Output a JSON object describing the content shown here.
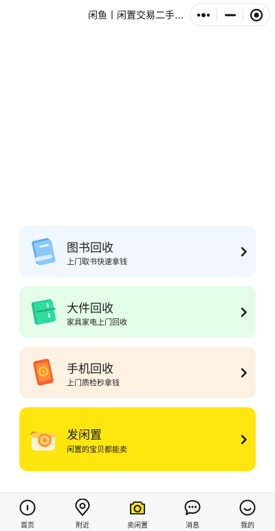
{
  "header": {
    "title": "闲鱼丨闲置交易二手...",
    "capsule": [
      "more-icon",
      "minimize-icon",
      "close-target-icon"
    ]
  },
  "cards": [
    {
      "title": "图书回收",
      "subtitle": "上门取书快速拿钱",
      "background": "#f1f7fe",
      "icon": "book-icon"
    },
    {
      "title": "大件回收",
      "subtitle": "家具家电上门回收",
      "background": "#e4fde8",
      "icon": "fridge-icon"
    },
    {
      "title": "手机回收",
      "subtitle": "上门质检秒拿钱",
      "background": "#fdf2e2",
      "icon": "phone-icon"
    },
    {
      "title": "发闲置",
      "subtitle": "闲置的宝贝都能卖",
      "background": "#ffe60f",
      "icon": "camera-icon"
    }
  ],
  "tabbar": {
    "items": [
      {
        "label": "首页",
        "icon": "home-icon"
      },
      {
        "label": "附近",
        "icon": "location-pin-icon"
      },
      {
        "label": "卖闲置",
        "icon": "camera-icon",
        "active": true
      },
      {
        "label": "消息",
        "icon": "chat-bubble-icon"
      },
      {
        "label": "我的",
        "icon": "smile-face-icon"
      }
    ]
  },
  "colors": {
    "accent": "#ffe60f",
    "tabbar_bg": "#f7f7f7"
  }
}
